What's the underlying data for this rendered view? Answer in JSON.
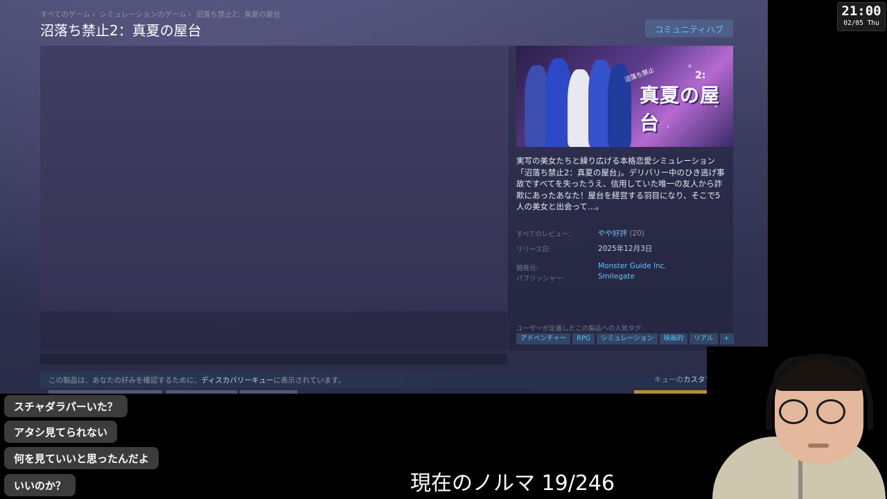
{
  "store": {
    "breadcrumb": [
      "すべてのゲーム",
      "シミュレーションのゲーム",
      "沼落ち禁止2：真夏の屋台"
    ],
    "title": "沼落ち禁止2：真夏の屋台",
    "community_hub": "コミュニティハブ",
    "capsule": {
      "logo_small": "沼落ち禁止",
      "logo_num": "2:",
      "logo_big": "真夏の屋台"
    },
    "description": "実写の美女たちと繰り広げる本格恋愛シミュレーション「沼落ち禁止2：真夏の屋台」。デリバリー中のひき逃げ事故ですべてを失ったうえ、信用していた唯一の友人から詐欺にあったあなた！屋台を経営する羽目になり、そこで5人の美女と出会って…。",
    "reviews_label": "すべてのレビュー：",
    "reviews_value": "やや好評",
    "reviews_count": "(20)",
    "release_label": "リリース日:",
    "release_value": "2025年12月3日",
    "developer_label": "開発元:",
    "developer_value": "Monster Guide Inc.",
    "publisher_label": "パブリッシャー:",
    "publisher_value": "Smilegate",
    "tags_label": "ユーザーが定義したこの製品への人気タグ:",
    "tags": [
      "アドベンチャー",
      "RPG",
      "シミュレーション",
      "映画的",
      "リアル",
      "+"
    ],
    "queue_text_pre": "この製品は、あなたの好みを確認するために、",
    "queue_text_hl": "ディスカバリーキュー",
    "queue_text_post": "に表示されています。",
    "queue_custom_pre": "キューの",
    "queue_custom_hl": "カスタマイズ"
  },
  "clock": {
    "time": "21:00",
    "date": "02/05 Thu"
  },
  "chat": [
    "スチャダラパーいた？",
    "アタシ見てられない",
    "何を見ていいと思ったんだよ",
    "いいのか？"
  ],
  "quota": "現在のノルマ 19/246",
  "colors": {
    "link": "#67c1f5",
    "bg": "#3b3d60"
  }
}
